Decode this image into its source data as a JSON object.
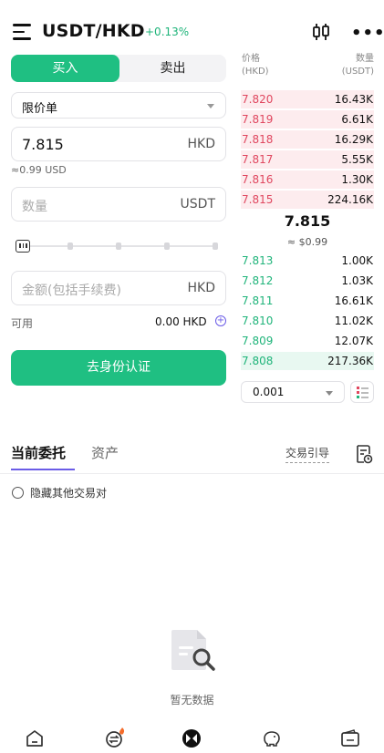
{
  "header": {
    "pair": "USDT/HKD",
    "change": "+0.13%",
    "menu_icon": "menu-icon",
    "chart_icon": "candlestick-icon",
    "more_icon": "more-dots-icon"
  },
  "form": {
    "buy_tab": "买入",
    "sell_tab": "卖出",
    "order_type": "限价单",
    "price_value": "7.815",
    "price_unit": "HKD",
    "price_approx": "≈0.99 USD",
    "quantity_placeholder": "数量",
    "quantity_unit": "USDT",
    "slider_percent": 0,
    "amount_placeholder": "金额(包括手续费)",
    "amount_unit": "HKD",
    "available_label": "可用",
    "available_value": "0.00 HKD",
    "verify_button": "去身份认证"
  },
  "orderbook": {
    "price_header": "价格",
    "price_unit": "(HKD)",
    "qty_header": "数量",
    "qty_unit": "(USDT)",
    "asks": [
      {
        "price": "7.820",
        "qty": "16.43K"
      },
      {
        "price": "7.819",
        "qty": "6.61K"
      },
      {
        "price": "7.818",
        "qty": "16.29K"
      },
      {
        "price": "7.817",
        "qty": "5.55K"
      },
      {
        "price": "7.816",
        "qty": "1.30K"
      },
      {
        "price": "7.815",
        "qty": "224.16K"
      }
    ],
    "mid_price": "7.815",
    "mid_usd": "≈ $0.99",
    "bids": [
      {
        "price": "7.813",
        "qty": "1.00K"
      },
      {
        "price": "7.812",
        "qty": "1.03K"
      },
      {
        "price": "7.811",
        "qty": "16.61K"
      },
      {
        "price": "7.810",
        "qty": "11.02K"
      },
      {
        "price": "7.809",
        "qty": "12.07K"
      },
      {
        "price": "7.808",
        "qty": "217.36K"
      }
    ],
    "precision": "0.001"
  },
  "orders": {
    "tab_current": "当前委托",
    "tab_assets": "资产",
    "guide_link": "交易引导",
    "hide_others": "隐藏其他交易对",
    "empty_text": "暂无数据"
  },
  "colors": {
    "accent_green": "#1fbf82",
    "ask_red": "#e0475f",
    "accent_purple": "#6b5ce7"
  },
  "bottom_nav": [
    "home-icon",
    "exchange-icon",
    "trade-icon",
    "savings-icon",
    "wallet-icon"
  ]
}
